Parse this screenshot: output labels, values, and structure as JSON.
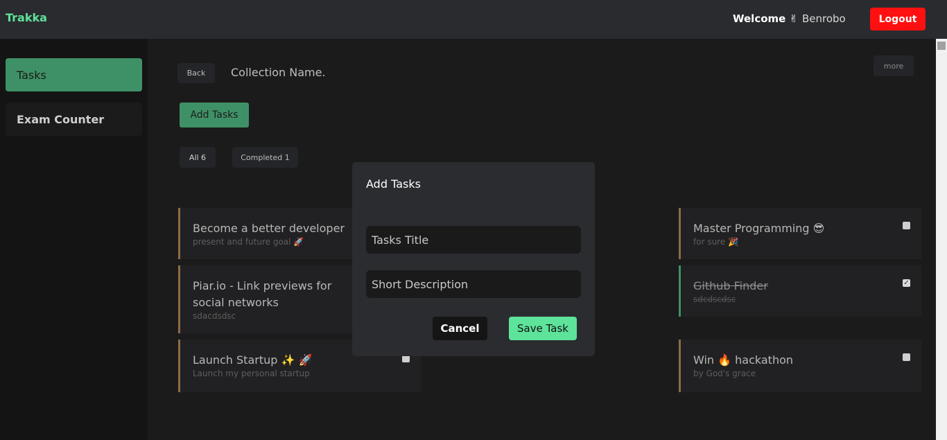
{
  "app": {
    "brand": "Trakka"
  },
  "header": {
    "welcome": "Welcome ✌",
    "username": "Benrobo",
    "logout_label": "Logout"
  },
  "sidebar": {
    "items": [
      {
        "label": "Tasks"
      },
      {
        "label": "Exam Counter"
      }
    ]
  },
  "collection": {
    "back_label": "Back",
    "name": "Collection Name.",
    "more_label": "more",
    "add_tasks_label": "Add Tasks"
  },
  "filters": {
    "all": "All 6",
    "completed": "Completed 1"
  },
  "tasks_left": [
    {
      "title": "Become a better developer",
      "desc": "present and future goal 🚀"
    },
    {
      "title": "Piar.io - Link previews for social networks",
      "desc": "sdacdsdsc"
    },
    {
      "title": "Launch Startup ✨ 🚀",
      "desc": "Launch my personal startup"
    }
  ],
  "tasks_right": [
    {
      "title": "Master Programming 😎",
      "desc": "for sure 🎉",
      "completed": false
    },
    {
      "title": "Github Finder",
      "desc": "sdcdscdsc",
      "completed": true
    },
    {
      "title": "Win 🔥 hackathon",
      "desc": "by God's grace",
      "completed": false
    }
  ],
  "modal": {
    "title": "Add Tasks",
    "title_placeholder": "Tasks Title",
    "desc_placeholder": "Short Description",
    "cancel_label": "Cancel",
    "save_label": "Save Task"
  },
  "colors": {
    "accent": "#5ee39a",
    "accent_dark": "#3e9166",
    "danger": "#ff1010",
    "pending_border": "#8f6b46"
  }
}
